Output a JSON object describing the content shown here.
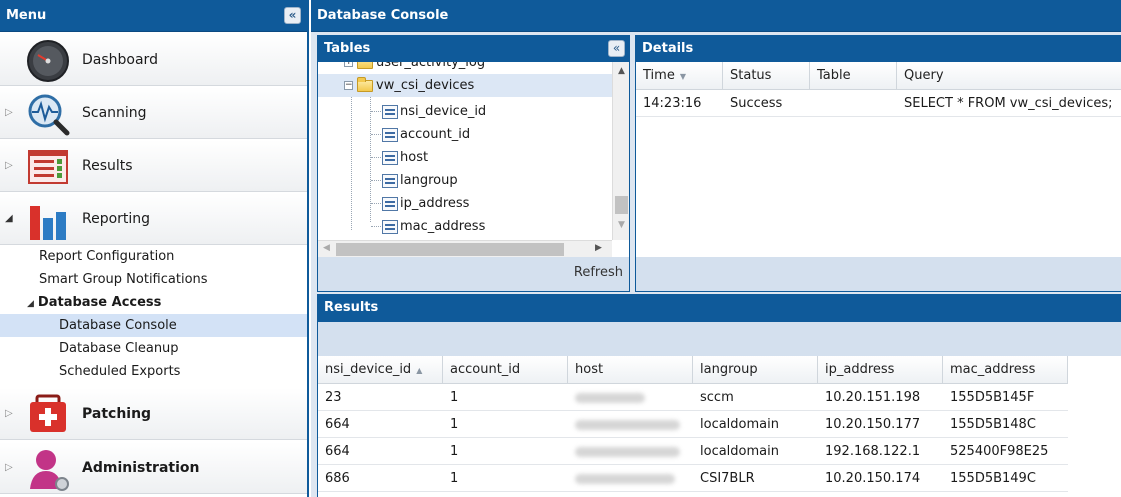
{
  "menu": {
    "title": "Menu",
    "collapse_glyph": "«",
    "sections": [
      {
        "label": "Dashboard",
        "icon": "dashboard-gauge-icon"
      },
      {
        "label": "Scanning",
        "icon": "scanning-magnifier-icon"
      },
      {
        "label": "Results",
        "icon": "results-list-icon"
      },
      {
        "label": "Reporting",
        "icon": "reporting-bar-chart-icon"
      },
      {
        "label": "Patching",
        "icon": "patching-medkit-icon"
      },
      {
        "label": "Administration",
        "icon": "administration-user-icon"
      }
    ],
    "reporting_items": {
      "report_configuration": "Report Configuration",
      "smart_group_notifications": "Smart Group Notifications",
      "database_access": "Database Access",
      "database_console": "Database Console",
      "database_cleanup": "Database Cleanup",
      "scheduled_exports": "Scheduled Exports"
    }
  },
  "console": {
    "title": "Database Console",
    "tables": {
      "title": "Tables",
      "collapse_glyph": "«",
      "tree": {
        "partial_item": "user_activity_log",
        "expanded_item": "vw_csi_devices",
        "columns": [
          "nsi_device_id",
          "account_id",
          "host",
          "langroup",
          "ip_address",
          "mac_address"
        ]
      },
      "refresh_label": "Refresh"
    },
    "details": {
      "title": "Details",
      "columns": [
        "Time",
        "Status",
        "Table",
        "Query"
      ],
      "rows": [
        {
          "time": "14:23:16",
          "status": "Success",
          "table": "",
          "query": "SELECT * FROM vw_csi_devices;"
        }
      ]
    },
    "results": {
      "title": "Results",
      "columns": [
        "nsi_device_id",
        "account_id",
        "host",
        "langroup",
        "ip_address",
        "mac_address"
      ],
      "rows": [
        {
          "nsi_device_id": "23",
          "account_id": "1",
          "langroup": "sccm",
          "ip_address": "10.20.151.198",
          "mac_address": "155D5B145F"
        },
        {
          "nsi_device_id": "664",
          "account_id": "1",
          "langroup": "localdomain",
          "ip_address": "10.20.150.177",
          "mac_address": "155D5B148C"
        },
        {
          "nsi_device_id": "664",
          "account_id": "1",
          "langroup": "localdomain",
          "ip_address": "192.168.122.1",
          "mac_address": "525400F98E25"
        },
        {
          "nsi_device_id": "686",
          "account_id": "1",
          "langroup": "CSI7BLR",
          "ip_address": "10.20.150.174",
          "mac_address": "155D5B149C"
        }
      ]
    }
  },
  "colors": {
    "header_blue": "#0f5a9a",
    "selected_row": "#d3e2f6",
    "toolbar": "#d4e0ee"
  }
}
